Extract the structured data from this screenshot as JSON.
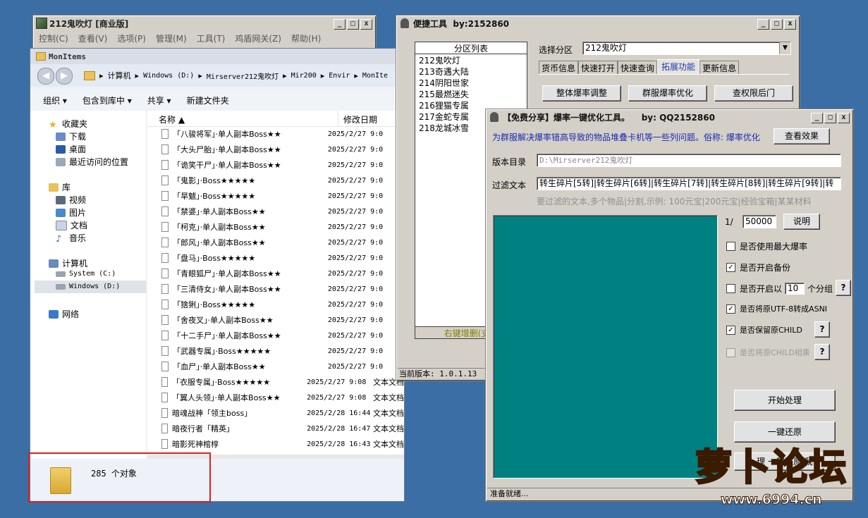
{
  "app_main": {
    "title": "212鬼吹灯 [商业版]",
    "menu": [
      "控制(C)",
      "查看(V)",
      "选项(P)",
      "管理(M)",
      "工具(T)",
      "鸡盾网关(Z)",
      "帮助(H)"
    ]
  },
  "explorer": {
    "title": "MonItems",
    "breadcrumb": [
      "计算机",
      "Windows (D:)",
      "Mirserver212鬼吹灯",
      "Mir200",
      "Envir",
      "MonIte"
    ],
    "toolbar": {
      "organize": "组织",
      "include": "包含到库中",
      "share": "共享",
      "new_folder": "新建文件夹"
    },
    "sidebar": {
      "favorites": "收藏夹",
      "fav_items": [
        "下载",
        "桌面",
        "最近访问的位置"
      ],
      "library": "库",
      "lib_items": [
        "视频",
        "图片",
        "文档",
        "音乐"
      ],
      "computer": "计算机",
      "drives": [
        "System (C:)",
        "Windows (D:)"
      ],
      "network": "网络"
    },
    "columns": {
      "name": "名称",
      "date": "修改日期"
    },
    "files": [
      {
        "name": "「八骏将军」·单人副本Boss★★",
        "date": "2025/2/27 9:0",
        "type": ""
      },
      {
        "name": "「大头尸胎」·单人副本Boss★★",
        "date": "2025/2/27 9:0",
        "type": ""
      },
      {
        "name": "「诡笑干尸」·单人副本Boss★★",
        "date": "2025/2/27 9:0",
        "type": ""
      },
      {
        "name": "「鬼影」·Boss★★★★★",
        "date": "2025/2/27 9:0",
        "type": ""
      },
      {
        "name": "「旱魃」·Boss★★★★★",
        "date": "2025/2/27 9:0",
        "type": ""
      },
      {
        "name": "「禁婆」·单人副本Boss★★",
        "date": "2025/2/27 9:0",
        "type": ""
      },
      {
        "name": "「柯克」·单人副本Boss★★",
        "date": "2025/2/27 9:0",
        "type": ""
      },
      {
        "name": "「郎风」·单人副本Boss★★",
        "date": "2025/2/27 9:0",
        "type": ""
      },
      {
        "name": "「盘马」·Boss★★★★★",
        "date": "2025/2/27 9:0",
        "type": ""
      },
      {
        "name": "「青眼狐尸」·单人副本Boss★★",
        "date": "2025/2/27 9:0",
        "type": ""
      },
      {
        "name": "「三清侍女」·单人副本Boss★★",
        "date": "2025/2/27 9:0",
        "type": ""
      },
      {
        "name": "「猞猁」·Boss★★★★★",
        "date": "2025/2/27 9:0",
        "type": ""
      },
      {
        "name": "「舍夜叉」·单人副本Boss★★",
        "date": "2025/2/27 9:0",
        "type": ""
      },
      {
        "name": "「十二手尸」·单人副本Boss★★",
        "date": "2025/2/27 9:0",
        "type": ""
      },
      {
        "name": "「武器专属」·Boss★★★★★",
        "date": "2025/2/27 9:0",
        "type": ""
      },
      {
        "name": "「血尸」·单人副本Boss★★",
        "date": "2025/2/27 9:0",
        "type": ""
      },
      {
        "name": "「衣服专属」·Boss★★★★★",
        "date": "2025/2/27 9:08",
        "type": "文本文档"
      },
      {
        "name": "「翼人头领」·单人副本Boss★★",
        "date": "2025/2/27 9:08",
        "type": "文本文档"
      },
      {
        "name": "暗魂战神「领主boss」",
        "date": "2025/2/28 16:44",
        "type": "文本文档"
      },
      {
        "name": "暗夜行者「精英」",
        "date": "2025/2/28 16:47",
        "type": "文本文档"
      },
      {
        "name": "暗影死神棺椁",
        "date": "2025/2/28 16:43",
        "type": "文本文档"
      }
    ],
    "status": "285 个对象"
  },
  "quick": {
    "title": "便捷工具  by:2152860",
    "list_header": "分区列表",
    "zones": [
      "212鬼吹灯",
      "213奇遇大陆",
      "214阴阳世家",
      "215最燃迷失",
      "216狸猫专属",
      "217金蛇专属",
      "218龙城冰雪"
    ],
    "list_footer": "右键增删(支持",
    "select_label": "选择分区",
    "select_value": "212鬼吹灯",
    "tabs": [
      "货币信息",
      "快速打开",
      "快速查询",
      "拓展功能",
      "更新信息"
    ],
    "buttons": [
      "整体爆率调整",
      "群服爆率优化",
      "查权限后门"
    ],
    "version": "当前版本: 1.0.1.13"
  },
  "opt": {
    "title": "【免费分享】爆率一键优化工具。    by: QQ2152860",
    "desc": "为群服解决爆率错高导致的物品堆叠卡机等一些列问题。俗称: 爆率优化",
    "view_btn": "查看效果",
    "dir_label": "版本目录",
    "dir_value": "D:\\Mirserver212鬼吹灯",
    "filter_label": "过滤文本",
    "filter_value": "转生碎片[5转]|转生碎片[6转]|转生碎片[7转]|转生碎片[8转]|转生碎片[9转]|转",
    "filter_hint": "要过滤的文本,多个物品|分割,示例: 100元宝|200元宝|经验宝箱|某某材料",
    "ratio_prefix": "1/",
    "ratio_value": "50000",
    "explain_btn": "说明",
    "opt_max": "是否使用最大爆率",
    "opt_backup": "是否开启备份",
    "opt_group_a": "是否开启以",
    "group_value": "10",
    "opt_group_b": "个分组",
    "opt_utf8": "是否将原UTF-8转成ASNI",
    "opt_child": "是否保留原CHILD",
    "opt_child2": "是否将原CHILD相乘",
    "q": "?",
    "start_btn": "开始处理",
    "restore_btn": "一键还原",
    "partial_btn": "理 一键还原 我",
    "status": "准备就绪..."
  },
  "watermark": {
    "brand": "萝卜论坛",
    "url": "www.6994.cn"
  }
}
